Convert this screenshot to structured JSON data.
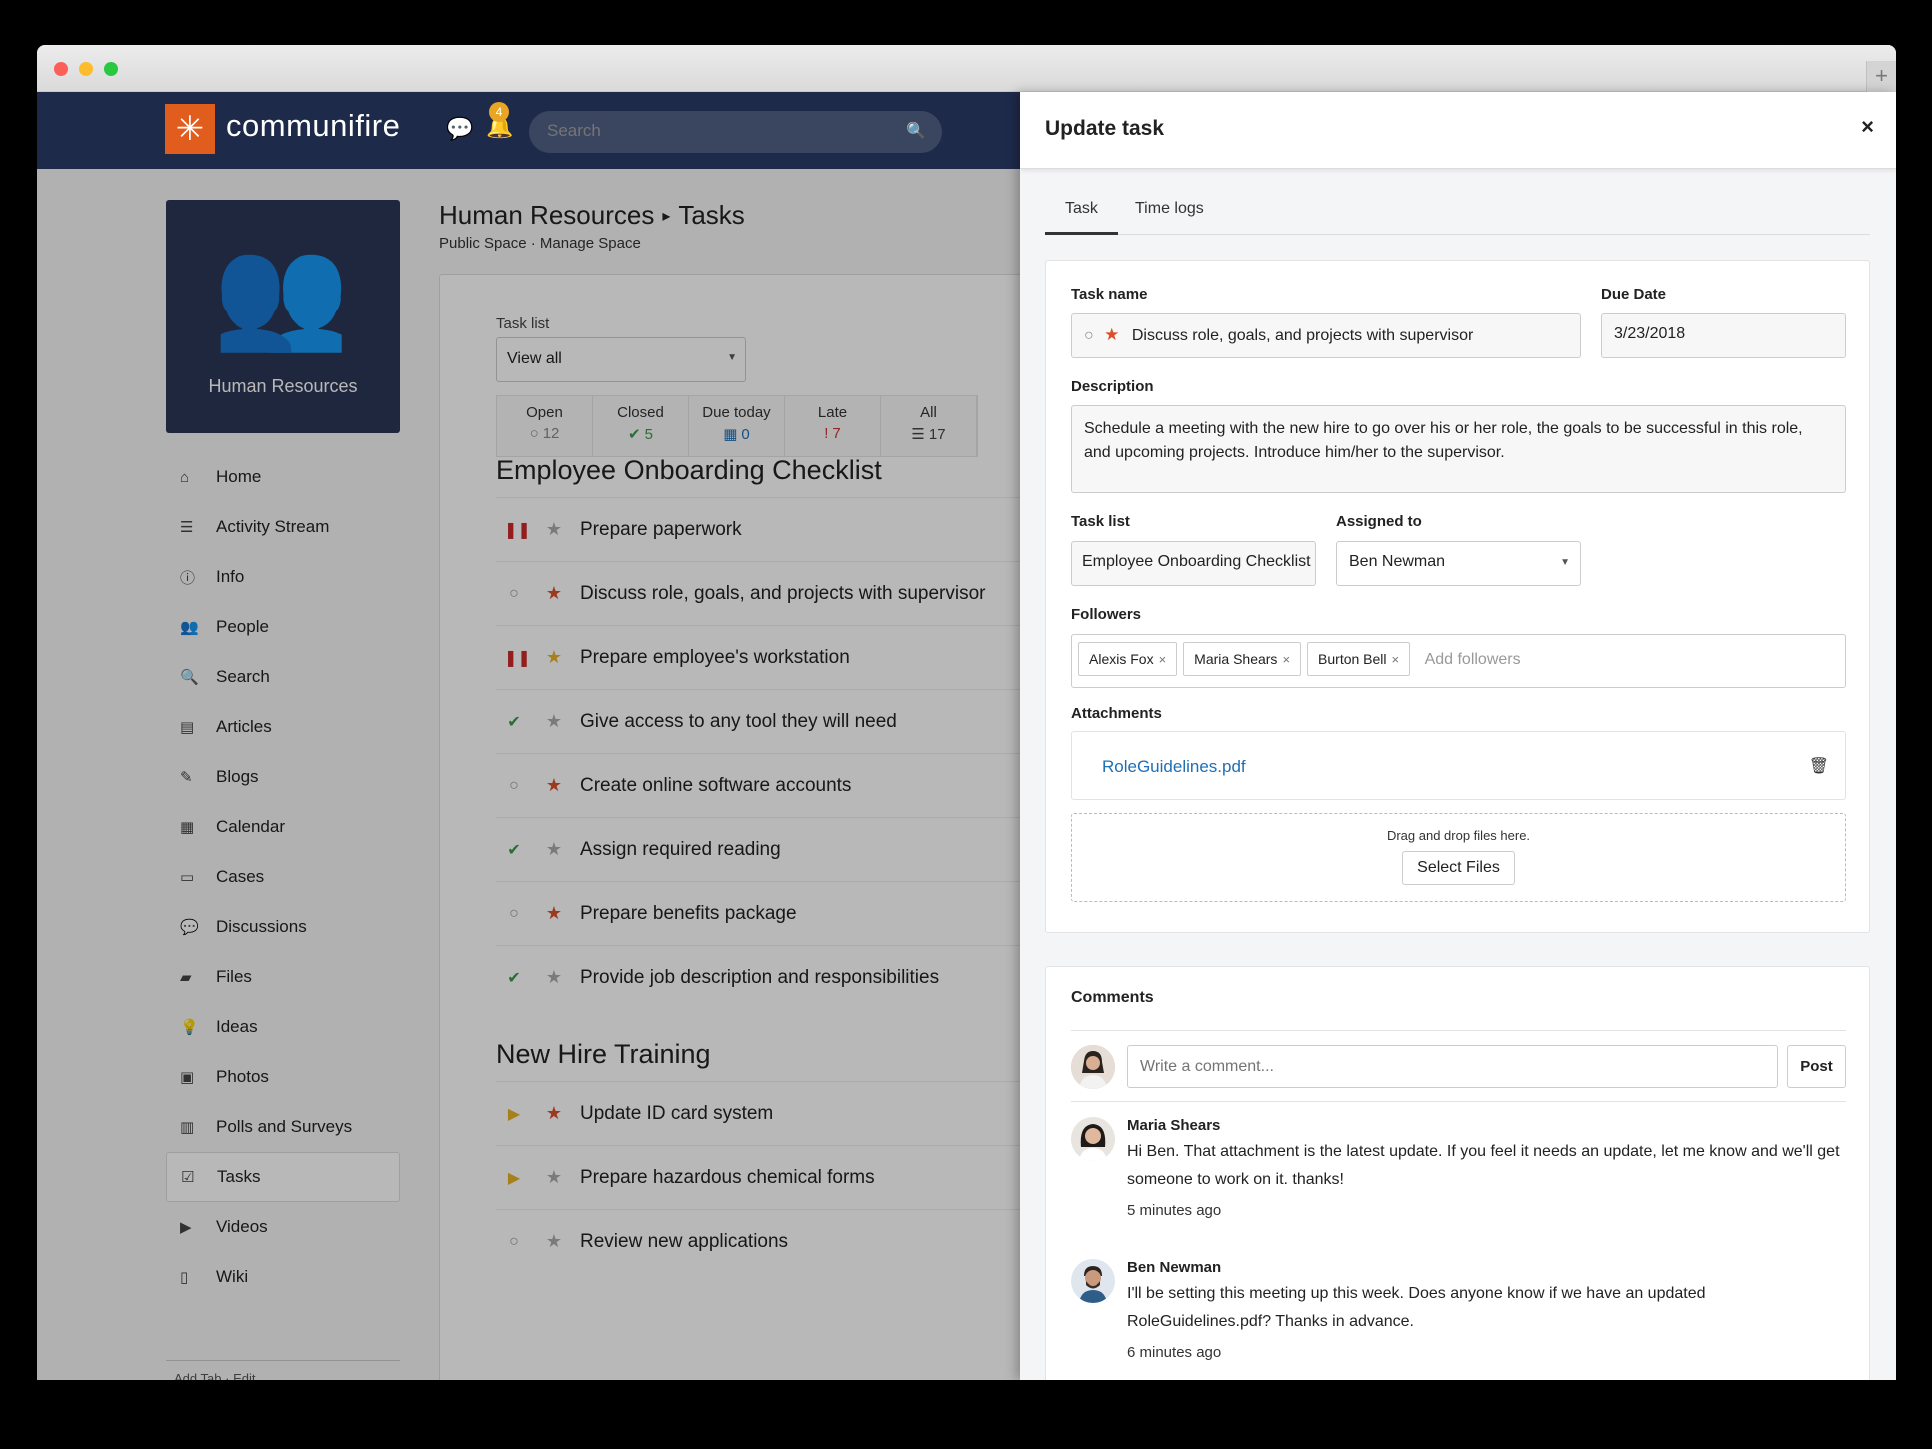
{
  "app": {
    "brand": "communifire",
    "notifications_count": "4",
    "search_placeholder": "Search"
  },
  "space": {
    "name": "Human Resources"
  },
  "sidebar": {
    "items": [
      {
        "label": "Home",
        "icon": "home-icon"
      },
      {
        "label": "Activity Stream",
        "icon": "list-icon"
      },
      {
        "label": "Info",
        "icon": "info-icon"
      },
      {
        "label": "People",
        "icon": "people-icon"
      },
      {
        "label": "Search",
        "icon": "search-icon"
      },
      {
        "label": "Articles",
        "icon": "file-icon"
      },
      {
        "label": "Blogs",
        "icon": "blog-icon"
      },
      {
        "label": "Calendar",
        "icon": "calendar-icon"
      },
      {
        "label": "Cases",
        "icon": "briefcase-icon"
      },
      {
        "label": "Discussions",
        "icon": "comments-icon"
      },
      {
        "label": "Files",
        "icon": "folder-icon"
      },
      {
        "label": "Ideas",
        "icon": "lightbulb-icon"
      },
      {
        "label": "Photos",
        "icon": "image-icon"
      },
      {
        "label": "Polls and Surveys",
        "icon": "bar-chart-icon"
      },
      {
        "label": "Tasks",
        "icon": "checkbox-icon"
      },
      {
        "label": "Videos",
        "icon": "video-icon"
      },
      {
        "label": "Wiki",
        "icon": "book-icon"
      }
    ],
    "footer": {
      "add_tab": "Add Tab",
      "sep": "·",
      "edit": "Edit"
    }
  },
  "page": {
    "breadcrumb_space": "Human Resources",
    "breadcrumb_sep": "▸",
    "breadcrumb_page": "Tasks",
    "sub_public": "Public Space",
    "sub_sep": "·",
    "sub_manage": "Manage Space",
    "tasklist_label": "Task list",
    "tasklist_value": "View all"
  },
  "counts": [
    {
      "label": "Open",
      "icon": "○",
      "value": "12",
      "color": "#888888"
    },
    {
      "label": "Closed",
      "icon": "✔",
      "value": "5",
      "color": "#3a9a4a"
    },
    {
      "label": "Due today",
      "icon": "▦",
      "value": "0",
      "color": "#1f6fb5"
    },
    {
      "label": "Late",
      "icon": "!",
      "value": "7",
      "color": "#cc3333"
    },
    {
      "label": "All",
      "icon": "☰",
      "value": "17",
      "color": "#444444"
    }
  ],
  "groups": [
    {
      "title": "Employee Onboarding Checklist",
      "tasks": [
        {
          "name": "Prepare paperwork",
          "status": "paused",
          "star": "gray"
        },
        {
          "name": "Discuss role, goals, and projects with supervisor",
          "status": "open",
          "star": "red"
        },
        {
          "name": "Prepare employee's workstation",
          "status": "paused",
          "star": "yellow"
        },
        {
          "name": "Give access to any tool they will need",
          "status": "done",
          "star": "gray"
        },
        {
          "name": "Create online software accounts",
          "status": "open",
          "star": "red"
        },
        {
          "name": "Assign required reading",
          "status": "done",
          "star": "gray"
        },
        {
          "name": "Prepare benefits package",
          "status": "open",
          "star": "red"
        },
        {
          "name": "Provide job description and responsibilities",
          "status": "done",
          "star": "gray"
        }
      ]
    },
    {
      "title": "New Hire Training",
      "tasks": [
        {
          "name": "Update ID card system",
          "status": "inprogress",
          "star": "red"
        },
        {
          "name": "Prepare hazardous chemical forms",
          "status": "inprogress",
          "star": "gray"
        },
        {
          "name": "Review new applications",
          "status": "open",
          "star": "gray"
        }
      ]
    }
  ],
  "panel": {
    "title": "Update task",
    "close": "×",
    "tabs": [
      "Task",
      "Time logs"
    ],
    "task_name_label": "Task name",
    "task_name": "Discuss role, goals, and projects with supervisor",
    "due_label": "Due Date",
    "due_value": "3/23/2018",
    "desc_label": "Description",
    "desc_value": "Schedule a meeting with the new hire to go over his or her role, the goals to be successful in this role, and upcoming projects. Introduce him/her to the supervisor.",
    "tasklist_label": "Task list",
    "tasklist_value": "Employee Onboarding Checklist",
    "assigned_label": "Assigned to",
    "assigned_value": "Ben Newman",
    "followers_label": "Followers",
    "followers": [
      "Alexis Fox",
      "Maria Shears",
      "Burton Bell"
    ],
    "followers_placeholder": "Add followers",
    "attachments_label": "Attachments",
    "attachment_file": "RoleGuidelines.pdf",
    "dropzone_text": "Drag and drop files here.",
    "select_files": "Select Files",
    "comments_label": "Comments",
    "comment_placeholder": "Write a comment...",
    "post_label": "Post",
    "comments": [
      {
        "author": "Maria Shears",
        "text": "Hi Ben. That attachment is the latest update. If you feel it needs an update, let me know and we'll get someone to work on it. thanks!",
        "time": "5 minutes ago"
      },
      {
        "author": "Ben Newman",
        "text": "I'll be setting this meeting up this week. Does anyone know if we have an updated RoleGuidelines.pdf? Thanks in advance.",
        "time": "6 minutes ago"
      }
    ]
  },
  "colors": {
    "brand_orange": "#e05d1e",
    "nav_bg": "#1e2a4a",
    "star_red": "#d94f2b",
    "star_yellow": "#e8b229",
    "done_green": "#3a9a4a",
    "paused_red": "#cc2a2a",
    "link_blue": "#1f6fb5"
  }
}
